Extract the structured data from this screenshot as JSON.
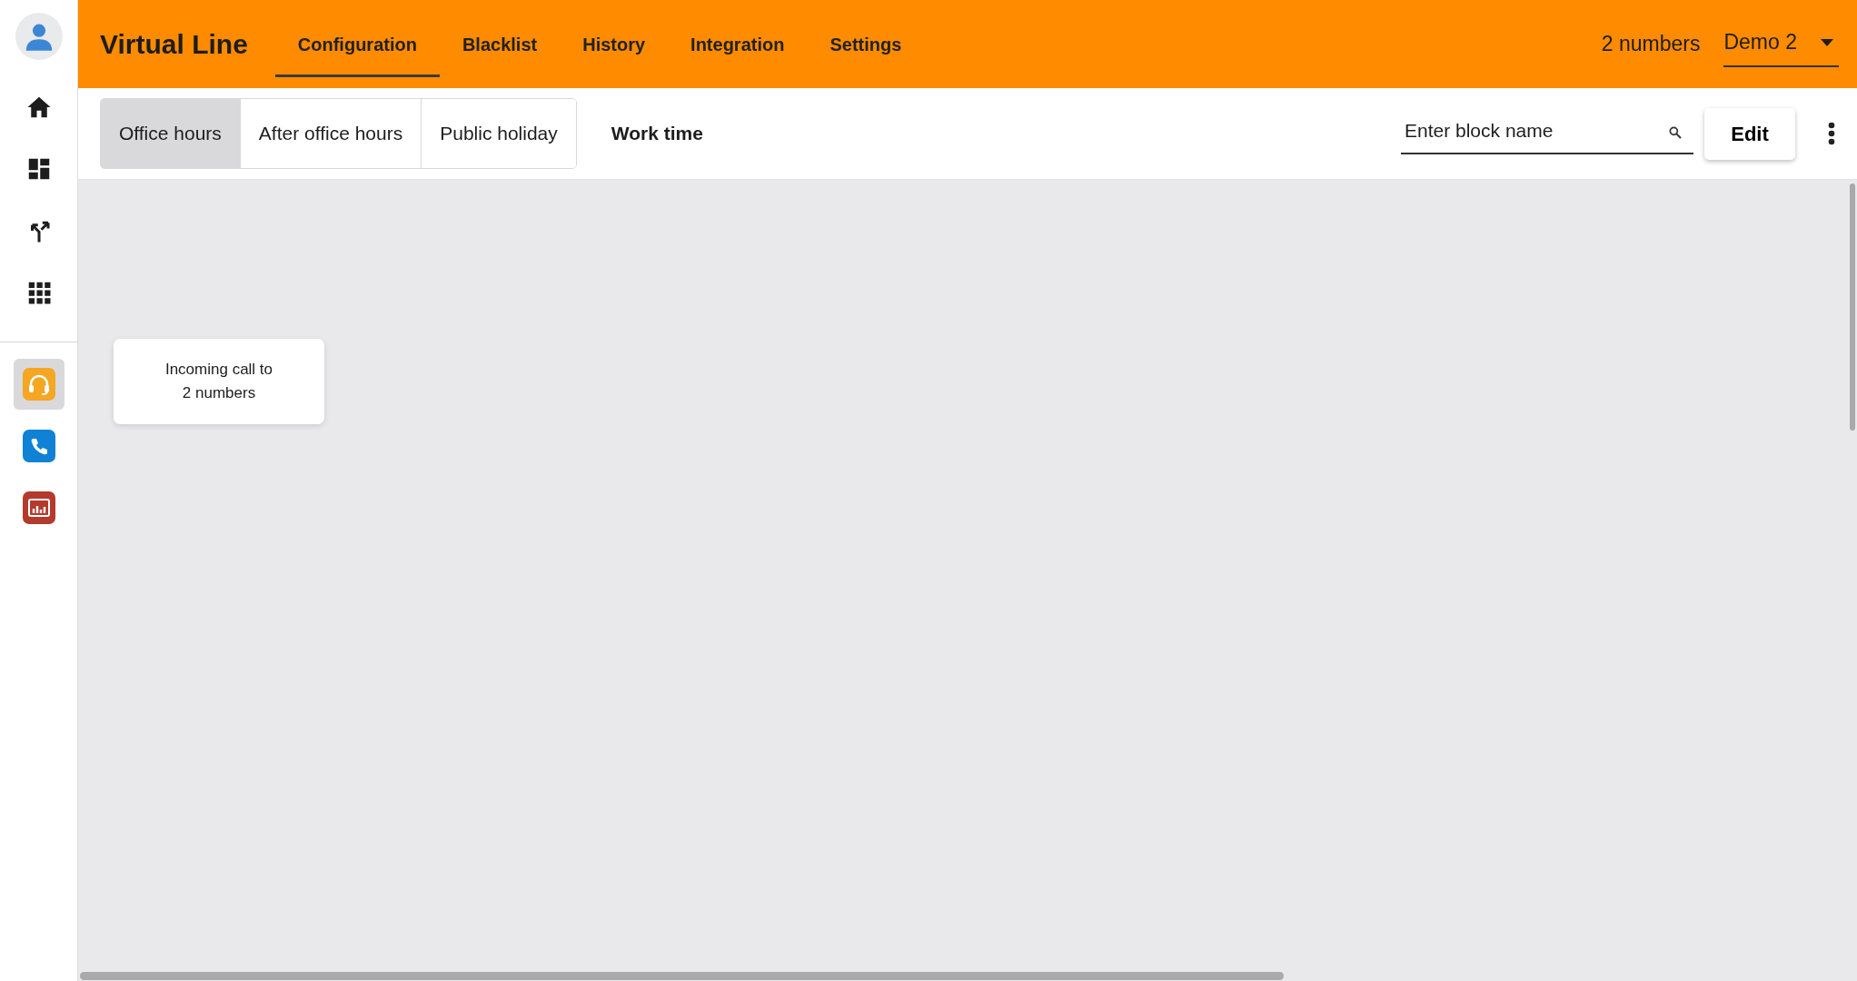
{
  "sidebar": {
    "nav_items": [
      {
        "kind": "home"
      },
      {
        "kind": "dashboard"
      },
      {
        "kind": "split"
      },
      {
        "kind": "apps"
      }
    ],
    "apps": [
      {
        "kind": "headset",
        "selected": true
      },
      {
        "kind": "phone",
        "selected": false
      },
      {
        "kind": "report",
        "selected": false
      }
    ]
  },
  "header": {
    "title": "Virtual Line",
    "tabs": [
      {
        "label": "Configuration",
        "selected": true
      },
      {
        "label": "Blacklist",
        "selected": false
      },
      {
        "label": "History",
        "selected": false
      },
      {
        "label": "Integration",
        "selected": false
      },
      {
        "label": "Settings",
        "selected": false
      }
    ],
    "count": "2 numbers",
    "account": "Demo 2"
  },
  "toolbar": {
    "modes": [
      {
        "label": "Office hours",
        "selected": true
      },
      {
        "label": "After office hours",
        "selected": false
      },
      {
        "label": "Public holiday",
        "selected": false
      }
    ],
    "schedule": "Work time",
    "search": {
      "placeholder": "Enter block name"
    },
    "edit_button": "Edit"
  },
  "canvas": {
    "blocks": [
      {
        "label": "Incoming call to 2 numbers"
      }
    ]
  }
}
